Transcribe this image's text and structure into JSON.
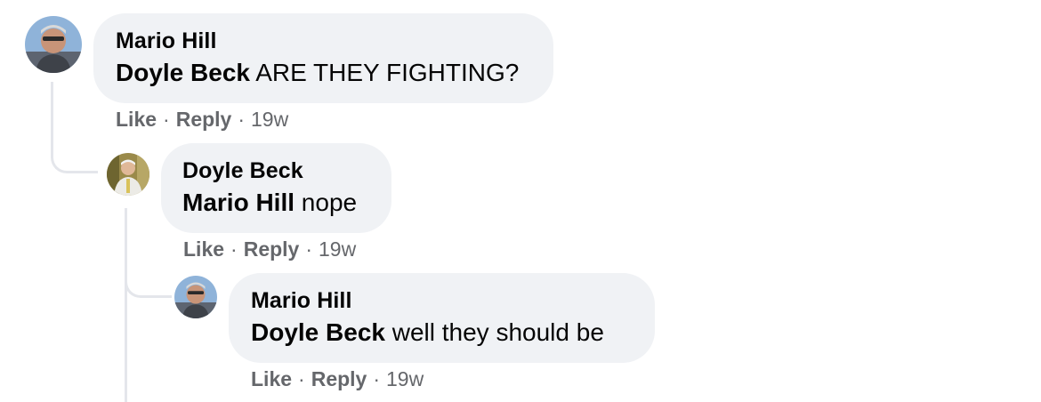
{
  "comments": [
    {
      "author": "Mario Hill",
      "mention": "Doyle Beck",
      "text": " ARE THEY FIGHTING?",
      "like_label": "Like",
      "reply_label": "Reply",
      "time": "19w"
    },
    {
      "author": "Doyle Beck",
      "mention": "Mario Hill",
      "text": " nope",
      "like_label": "Like",
      "reply_label": "Reply",
      "time": "19w"
    },
    {
      "author": "Mario Hill",
      "mention": "Doyle Beck",
      "text": " well they should be",
      "like_label": "Like",
      "reply_label": "Reply",
      "time": "19w"
    }
  ],
  "separator": "·",
  "colors": {
    "bubble": "#f0f2f5",
    "meta_text": "#65676b",
    "thread_line": "#e4e6eb",
    "text": "#050505"
  }
}
